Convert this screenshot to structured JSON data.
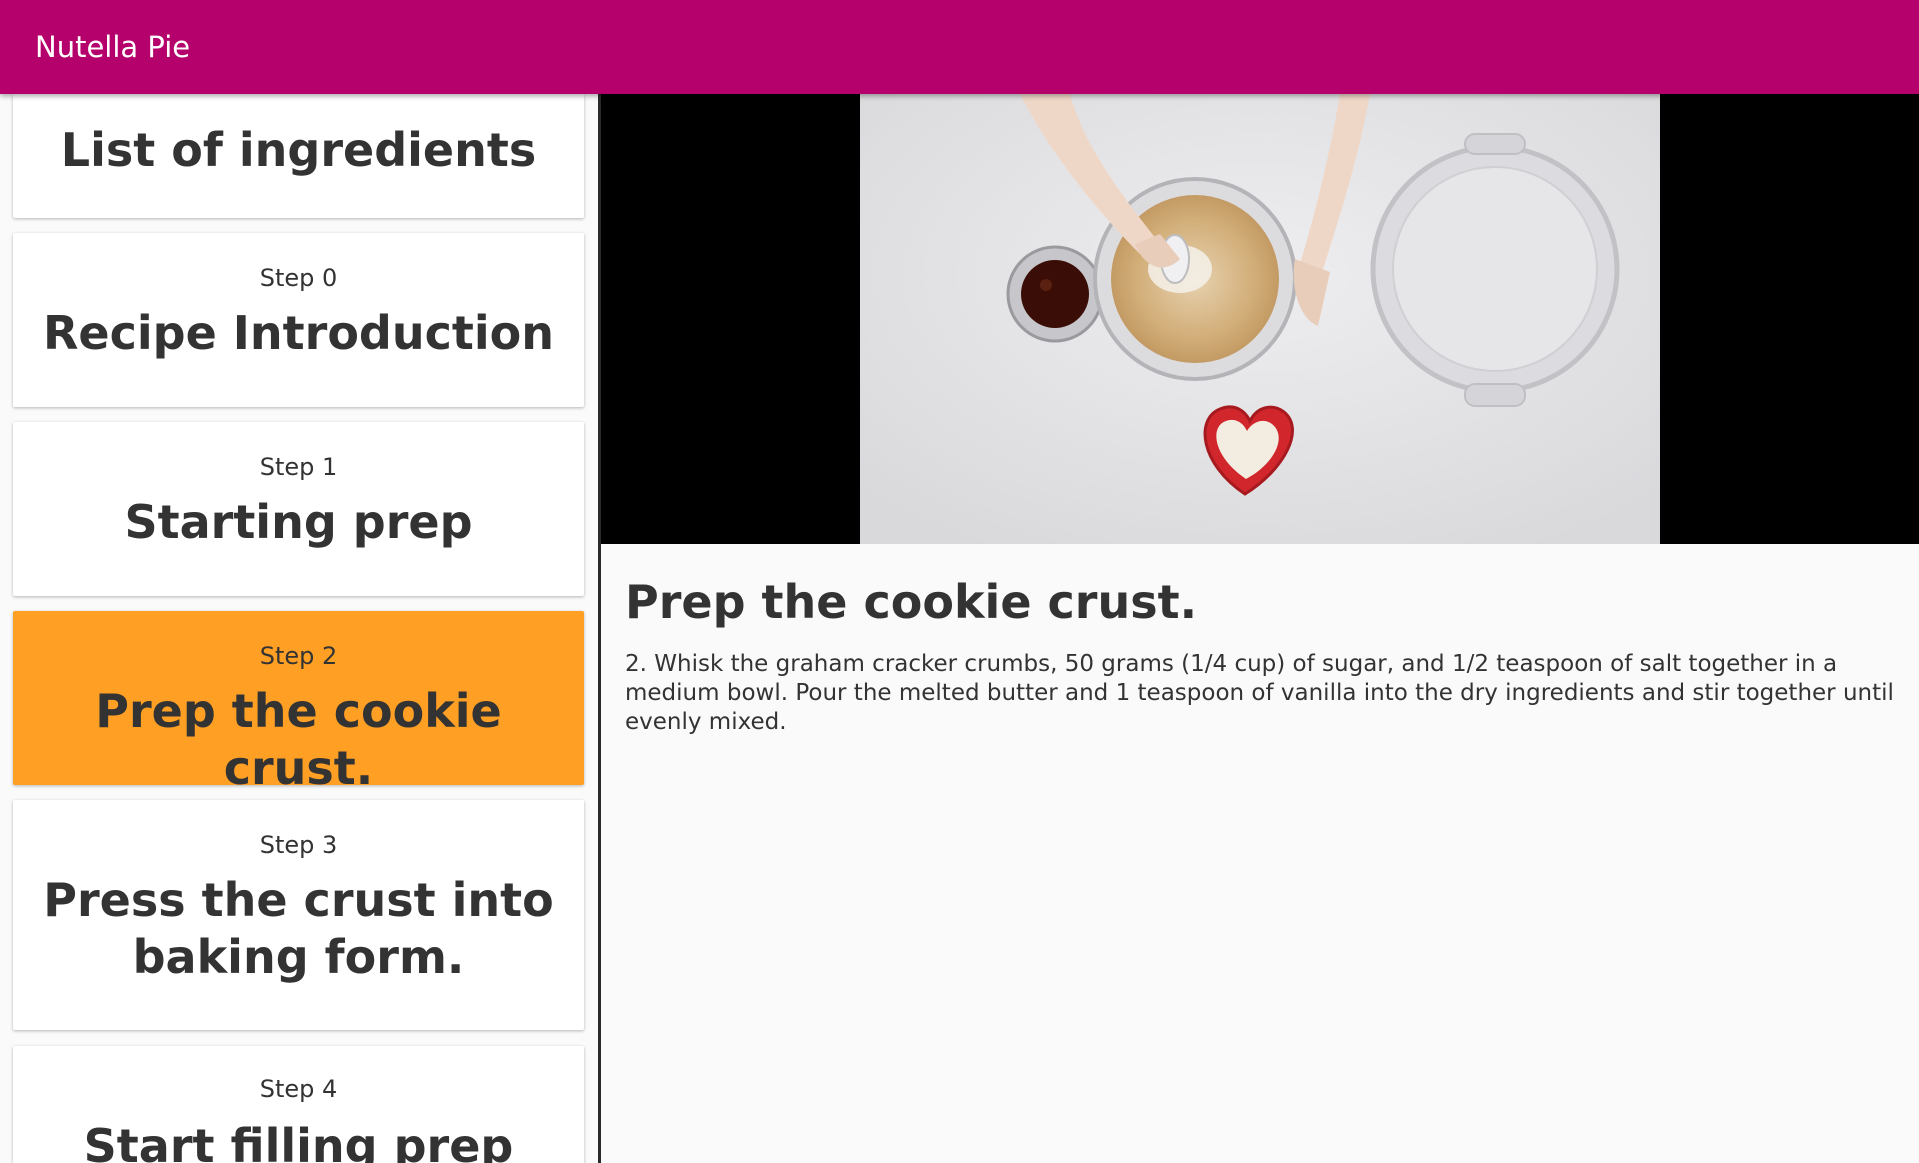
{
  "app": {
    "title": "Nutella Pie"
  },
  "colors": {
    "app_bar": "#b5016b",
    "selected_step": "#ffa024",
    "card": "#ffffff",
    "text": "#333333"
  },
  "steps": [
    {
      "step_label": "",
      "title": "List of ingredients",
      "selected": false
    },
    {
      "step_label": "Step 0",
      "title": "Recipe Introduction",
      "selected": false
    },
    {
      "step_label": "Step 1",
      "title": "Starting prep",
      "selected": false
    },
    {
      "step_label": "Step 2",
      "title": "Prep the cookie crust.",
      "selected": true
    },
    {
      "step_label": "Step 3",
      "title": "Press the crust into baking form.",
      "selected": false
    },
    {
      "step_label": "Step 4",
      "title": "Start filling prep",
      "selected": false
    }
  ],
  "detail": {
    "title": "Prep the cookie crust.",
    "description": "2. Whisk the graham cracker crumbs, 50 grams (1/4 cup) of sugar, and 1/2 teaspoon of salt together in a medium bowl. Pour the melted butter and 1 teaspoon of vanilla into the dry ingredients and stir together until evenly mixed."
  }
}
